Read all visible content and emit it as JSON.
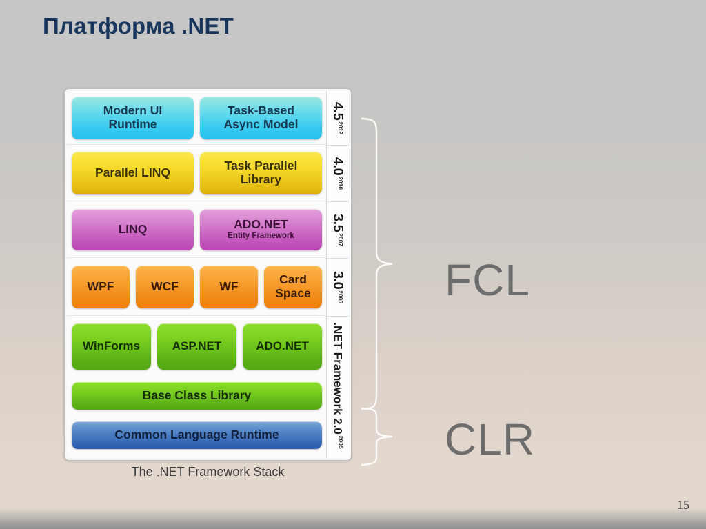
{
  "slide": {
    "title": "Платформа .NET",
    "page_number": "15",
    "background_top_color": "#c6c6c6",
    "background_bottom_color": "#e2d7cd",
    "title_color": "#18365e"
  },
  "figure": {
    "caption": "The .NET Framework Stack",
    "rows": [
      {
        "id": "row-45",
        "color": "#28c2ee",
        "theme": "cyan",
        "version": "4.5",
        "year": "2012",
        "boxes": [
          {
            "label": "Modern UI Runtime",
            "line1": "Modern UI",
            "line2": "Runtime"
          },
          {
            "label": "Task-Based Async Model",
            "line1": "Task-Based",
            "line2": "Async Model"
          }
        ]
      },
      {
        "id": "row-40",
        "color": "#e5bd12",
        "theme": "yellow",
        "version": "4.0",
        "year": "2010",
        "boxes": [
          {
            "label": "Parallel LINQ",
            "line1": "Parallel LINQ",
            "line2": ""
          },
          {
            "label": "Task Parallel Library",
            "line1": "Task Parallel",
            "line2": "Library"
          }
        ]
      },
      {
        "id": "row-35",
        "color": "#c255bc",
        "theme": "purple",
        "version": "3.5",
        "year": "2007",
        "boxes": [
          {
            "label": "LINQ",
            "line1": "LINQ",
            "line2": ""
          },
          {
            "label": "ADO.NET Entity Framework",
            "line1": "ADO.NET",
            "line2": "Entity Framework"
          }
        ]
      },
      {
        "id": "row-30",
        "color": "#f08713",
        "theme": "orange",
        "version": "3.0",
        "year": "2006",
        "boxes": [
          {
            "label": "WPF",
            "line1": "WPF",
            "line2": ""
          },
          {
            "label": "WCF",
            "line1": "WCF",
            "line2": ""
          },
          {
            "label": "WF",
            "line1": "WF",
            "line2": ""
          },
          {
            "label": "Card Space",
            "line1": "Card",
            "line2": "Space"
          }
        ]
      },
      {
        "id": "row-20",
        "color": "#5ab016",
        "theme": "green",
        "version": ".NET Framework 2.0",
        "year": "2005",
        "boxes": [
          {
            "label": "WinForms",
            "line1": "WinForms",
            "line2": ""
          },
          {
            "label": "ASP.NET",
            "line1": "ASP.NET",
            "line2": ""
          },
          {
            "label": "ADO.NET",
            "line1": "ADO.NET",
            "line2": ""
          }
        ]
      },
      {
        "id": "row-bcl",
        "color": "#5ab016",
        "theme": "green",
        "boxes": [
          {
            "label": "Base Class Library",
            "line1": "Base Class Library",
            "line2": ""
          }
        ]
      },
      {
        "id": "row-clr",
        "color": "#3465b4",
        "theme": "blue",
        "boxes": [
          {
            "label": "Common Language Runtime",
            "line1": "Common Language Runtime",
            "line2": ""
          }
        ]
      }
    ]
  },
  "groups": {
    "fcl": {
      "label": "FCL",
      "color": "#6d6d6d",
      "covers": [
        "4.5",
        "4.0",
        "3.5",
        "3.0",
        ".NET Framework 2.0",
        "Base Class Library"
      ]
    },
    "clr": {
      "label": "CLR",
      "color": "#6d6d6d",
      "covers": [
        "Common Language Runtime"
      ]
    }
  }
}
